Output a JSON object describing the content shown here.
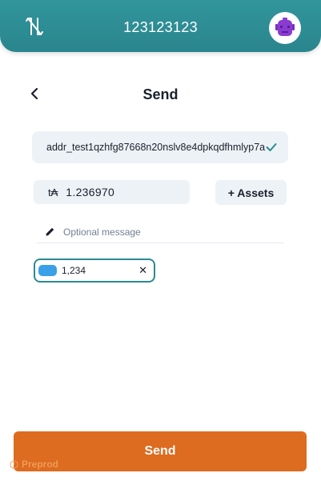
{
  "header": {
    "wallet_name": "123123123",
    "logo_icon": "nami-logo-icon",
    "avatar_icon": "robot-avatar-icon"
  },
  "page": {
    "title": "Send",
    "back_icon": "chevron-left-icon"
  },
  "address": {
    "value": "addr_test1qzhfg87668n20nslv8e4dpkqdfhmlyp7a",
    "valid_icon": "check-icon"
  },
  "amount": {
    "symbol": "t₳",
    "value": "1.236970"
  },
  "assets_button": {
    "label": "+ Assets"
  },
  "message": {
    "placeholder": "Optional message",
    "icon": "pencil-icon"
  },
  "asset_chip": {
    "amount": "1,234",
    "close": "✕"
  },
  "send_button": {
    "label": "Send"
  },
  "network": {
    "label": "Preprod",
    "icon": "info-circle-icon"
  },
  "colors": {
    "header": "#2b8a92",
    "accent": "#dd6b20",
    "input_bg": "#edf2f7"
  }
}
